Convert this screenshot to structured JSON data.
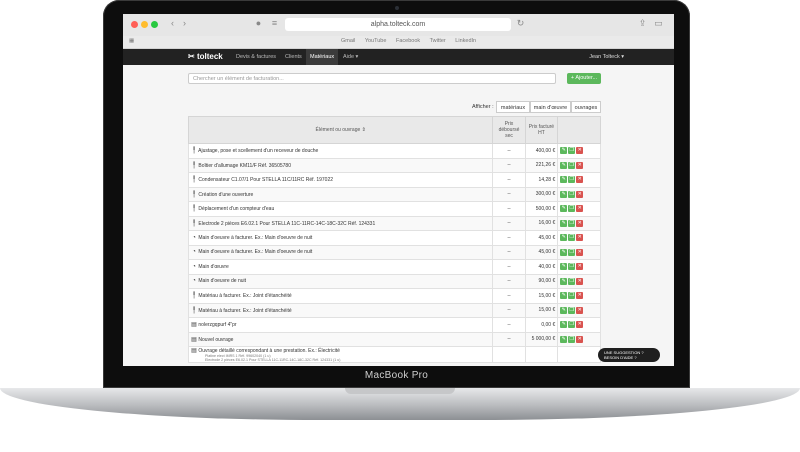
{
  "laptop": {
    "model": "MacBook Pro"
  },
  "browser": {
    "url": "alpha.tolteck.com",
    "bookmarks": [
      "Gmail",
      "YouTube",
      "Facebook",
      "Twitter",
      "LinkedIn"
    ]
  },
  "app": {
    "logo": "tolteck",
    "nav": [
      "Devis & factures",
      "Clients",
      "Matériaux",
      "Aide ▾"
    ],
    "user": "Jean Tolteck ▾"
  },
  "search": {
    "placeholder": "Chercher un élément de facturation..."
  },
  "add_label": "+ Ajouter...",
  "filter": {
    "label": "Afficher :",
    "tabs": [
      "matériaux",
      "main d'œuvre",
      "ouvrages"
    ]
  },
  "table": {
    "col_element": "Élément ou ouvrage",
    "col_debourse": "Prix déboursé sec",
    "col_facture": "Prix facturé HT",
    "rows": [
      {
        "label": "Ajustage, pose et scellement d'un receveur de douche",
        "debourse": "--",
        "prix": "400,00 €"
      },
      {
        "label": "Boîtier d'allumage KM11/F Réf. 36505780",
        "debourse": "--",
        "prix": "221,26 €"
      },
      {
        "label": "Condensateur C1.07/1 Pour STELLA 11C/11RC Réf. 197022",
        "debourse": "--",
        "prix": "14,28 €"
      },
      {
        "label": "Création d'une ouverture",
        "debourse": "--",
        "prix": "300,00 €"
      },
      {
        "label": "Déplacement d'un compteur d'eau",
        "debourse": "--",
        "prix": "500,00 €"
      },
      {
        "label": "Electrode 2 pièces E6.02.1 Pour STELLA 11C-11RC-14C-18C-32C Réf. 124331",
        "debourse": "--",
        "prix": "16,00 €"
      },
      {
        "label": "Main d'oeuvre à facturer. Ex.: Main d'oeuvre de nuit",
        "debourse": "--",
        "prix": "45,00 €"
      },
      {
        "label": "Main d'oeuvre à facturer. Ex.: Main d'oeuvre de nuit",
        "debourse": "--",
        "prix": "45,00 €"
      },
      {
        "label": "Main d'œuvre",
        "debourse": "--",
        "prix": "40,00 €"
      },
      {
        "label": "Main d'oeuvre de nuit",
        "debourse": "--",
        "prix": "90,00 €"
      },
      {
        "label": "Matériau à facturer. Ex.: Joint d'étanchéité",
        "debourse": "--",
        "prix": "15,00 €"
      },
      {
        "label": "Matériau à facturer. Ex.: Joint d'étanchéité",
        "debourse": "--",
        "prix": "15,00 €"
      },
      {
        "label": "nolerzgqpurf 4\"pr",
        "debourse": "--",
        "prix": "0,00 €"
      },
      {
        "label": "Nouvel ouvrage",
        "debourse": "--",
        "prix": "5 000,00 €"
      },
      {
        "label": "Ouvrage détaillé correspondant à une prestation.  Ex.: Électricité",
        "debourse": "",
        "prix": ""
      }
    ],
    "sub_lines": [
      "Platine elect IMRS 1 Réf. 99602040 (1 u)",
      "Electrode 2 pièces E6.02.1 Pour STELLA 11C-11RC-14C-18C-32C Réf. 124331 (1 u)"
    ]
  },
  "chat": {
    "line1": "UNE SUGGESTION ?",
    "line2": "BESOIN D'AIDE ?"
  }
}
